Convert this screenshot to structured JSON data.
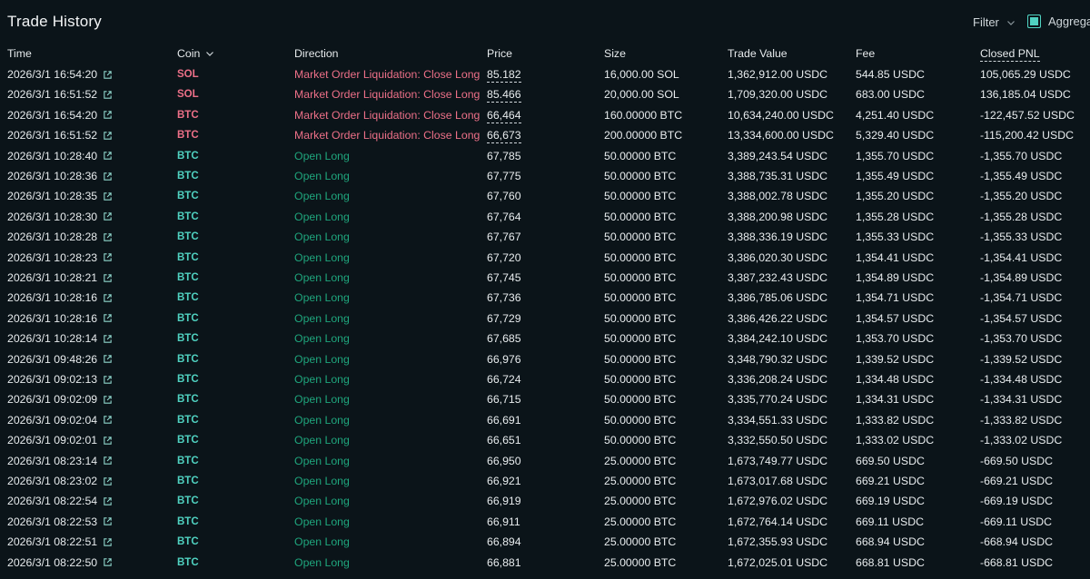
{
  "header": {
    "title": "Trade History",
    "filter_label": "Filter",
    "aggregate_label": "Aggregate"
  },
  "columns": {
    "time": "Time",
    "coin": "Coin",
    "direction": "Direction",
    "price": "Price",
    "size": "Size",
    "trade_value": "Trade Value",
    "fee": "Fee",
    "closed_pnl": "Closed PNL"
  },
  "colors": {
    "background": "#0b1419",
    "sell": "#ed7088",
    "buy_direction": "#1fa67d",
    "buy_coin": "#50d2c1"
  },
  "rows": [
    {
      "time": "2026/3/1 16:54:20",
      "coin": "SOL",
      "side": "sell",
      "direction": "Market Order Liquidation: Close Long",
      "price": "85.182",
      "size": "16,000.00 SOL",
      "value": "1,362,912.00 USDC",
      "fee": "544.85 USDC",
      "pnl": "105,065.29 USDC"
    },
    {
      "time": "2026/3/1 16:51:52",
      "coin": "SOL",
      "side": "sell",
      "direction": "Market Order Liquidation: Close Long",
      "price": "85.466",
      "size": "20,000.00 SOL",
      "value": "1,709,320.00 USDC",
      "fee": "683.00 USDC",
      "pnl": "136,185.04 USDC"
    },
    {
      "time": "2026/3/1 16:54:20",
      "coin": "BTC",
      "side": "sell",
      "direction": "Market Order Liquidation: Close Long",
      "price": "66,464",
      "size": "160.00000 BTC",
      "value": "10,634,240.00 USDC",
      "fee": "4,251.40 USDC",
      "pnl": "-122,457.52 USDC"
    },
    {
      "time": "2026/3/1 16:51:52",
      "coin": "BTC",
      "side": "sell",
      "direction": "Market Order Liquidation: Close Long",
      "price": "66,673",
      "size": "200.00000 BTC",
      "value": "13,334,600.00 USDC",
      "fee": "5,329.40 USDC",
      "pnl": "-115,200.42 USDC"
    },
    {
      "time": "2026/3/1 10:28:40",
      "coin": "BTC",
      "side": "buy",
      "direction": "Open Long",
      "price": "67,785",
      "size": "50.00000 BTC",
      "value": "3,389,243.54 USDC",
      "fee": "1,355.70 USDC",
      "pnl": "-1,355.70 USDC"
    },
    {
      "time": "2026/3/1 10:28:36",
      "coin": "BTC",
      "side": "buy",
      "direction": "Open Long",
      "price": "67,775",
      "size": "50.00000 BTC",
      "value": "3,388,735.31 USDC",
      "fee": "1,355.49 USDC",
      "pnl": "-1,355.49 USDC"
    },
    {
      "time": "2026/3/1 10:28:35",
      "coin": "BTC",
      "side": "buy",
      "direction": "Open Long",
      "price": "67,760",
      "size": "50.00000 BTC",
      "value": "3,388,002.78 USDC",
      "fee": "1,355.20 USDC",
      "pnl": "-1,355.20 USDC"
    },
    {
      "time": "2026/3/1 10:28:30",
      "coin": "BTC",
      "side": "buy",
      "direction": "Open Long",
      "price": "67,764",
      "size": "50.00000 BTC",
      "value": "3,388,200.98 USDC",
      "fee": "1,355.28 USDC",
      "pnl": "-1,355.28 USDC"
    },
    {
      "time": "2026/3/1 10:28:28",
      "coin": "BTC",
      "side": "buy",
      "direction": "Open Long",
      "price": "67,767",
      "size": "50.00000 BTC",
      "value": "3,388,336.19 USDC",
      "fee": "1,355.33 USDC",
      "pnl": "-1,355.33 USDC"
    },
    {
      "time": "2026/3/1 10:28:23",
      "coin": "BTC",
      "side": "buy",
      "direction": "Open Long",
      "price": "67,720",
      "size": "50.00000 BTC",
      "value": "3,386,020.30 USDC",
      "fee": "1,354.41 USDC",
      "pnl": "-1,354.41 USDC"
    },
    {
      "time": "2026/3/1 10:28:21",
      "coin": "BTC",
      "side": "buy",
      "direction": "Open Long",
      "price": "67,745",
      "size": "50.00000 BTC",
      "value": "3,387,232.43 USDC",
      "fee": "1,354.89 USDC",
      "pnl": "-1,354.89 USDC"
    },
    {
      "time": "2026/3/1 10:28:16",
      "coin": "BTC",
      "side": "buy",
      "direction": "Open Long",
      "price": "67,736",
      "size": "50.00000 BTC",
      "value": "3,386,785.06 USDC",
      "fee": "1,354.71 USDC",
      "pnl": "-1,354.71 USDC"
    },
    {
      "time": "2026/3/1 10:28:16",
      "coin": "BTC",
      "side": "buy",
      "direction": "Open Long",
      "price": "67,729",
      "size": "50.00000 BTC",
      "value": "3,386,426.22 USDC",
      "fee": "1,354.57 USDC",
      "pnl": "-1,354.57 USDC"
    },
    {
      "time": "2026/3/1 10:28:14",
      "coin": "BTC",
      "side": "buy",
      "direction": "Open Long",
      "price": "67,685",
      "size": "50.00000 BTC",
      "value": "3,384,242.10 USDC",
      "fee": "1,353.70 USDC",
      "pnl": "-1,353.70 USDC"
    },
    {
      "time": "2026/3/1 09:48:26",
      "coin": "BTC",
      "side": "buy",
      "direction": "Open Long",
      "price": "66,976",
      "size": "50.00000 BTC",
      "value": "3,348,790.32 USDC",
      "fee": "1,339.52 USDC",
      "pnl": "-1,339.52 USDC"
    },
    {
      "time": "2026/3/1 09:02:13",
      "coin": "BTC",
      "side": "buy",
      "direction": "Open Long",
      "price": "66,724",
      "size": "50.00000 BTC",
      "value": "3,336,208.24 USDC",
      "fee": "1,334.48 USDC",
      "pnl": "-1,334.48 USDC"
    },
    {
      "time": "2026/3/1 09:02:09",
      "coin": "BTC",
      "side": "buy",
      "direction": "Open Long",
      "price": "66,715",
      "size": "50.00000 BTC",
      "value": "3,335,770.24 USDC",
      "fee": "1,334.31 USDC",
      "pnl": "-1,334.31 USDC"
    },
    {
      "time": "2026/3/1 09:02:04",
      "coin": "BTC",
      "side": "buy",
      "direction": "Open Long",
      "price": "66,691",
      "size": "50.00000 BTC",
      "value": "3,334,551.33 USDC",
      "fee": "1,333.82 USDC",
      "pnl": "-1,333.82 USDC"
    },
    {
      "time": "2026/3/1 09:02:01",
      "coin": "BTC",
      "side": "buy",
      "direction": "Open Long",
      "price": "66,651",
      "size": "50.00000 BTC",
      "value": "3,332,550.50 USDC",
      "fee": "1,333.02 USDC",
      "pnl": "-1,333.02 USDC"
    },
    {
      "time": "2026/3/1 08:23:14",
      "coin": "BTC",
      "side": "buy",
      "direction": "Open Long",
      "price": "66,950",
      "size": "25.00000 BTC",
      "value": "1,673,749.77 USDC",
      "fee": "669.50 USDC",
      "pnl": "-669.50 USDC"
    },
    {
      "time": "2026/3/1 08:23:02",
      "coin": "BTC",
      "side": "buy",
      "direction": "Open Long",
      "price": "66,921",
      "size": "25.00000 BTC",
      "value": "1,673,017.68 USDC",
      "fee": "669.21 USDC",
      "pnl": "-669.21 USDC"
    },
    {
      "time": "2026/3/1 08:22:54",
      "coin": "BTC",
      "side": "buy",
      "direction": "Open Long",
      "price": "66,919",
      "size": "25.00000 BTC",
      "value": "1,672,976.02 USDC",
      "fee": "669.19 USDC",
      "pnl": "-669.19 USDC"
    },
    {
      "time": "2026/3/1 08:22:53",
      "coin": "BTC",
      "side": "buy",
      "direction": "Open Long",
      "price": "66,911",
      "size": "25.00000 BTC",
      "value": "1,672,764.14 USDC",
      "fee": "669.11 USDC",
      "pnl": "-669.11 USDC"
    },
    {
      "time": "2026/3/1 08:22:51",
      "coin": "BTC",
      "side": "buy",
      "direction": "Open Long",
      "price": "66,894",
      "size": "25.00000 BTC",
      "value": "1,672,355.93 USDC",
      "fee": "668.94 USDC",
      "pnl": "-668.94 USDC"
    },
    {
      "time": "2026/3/1 08:22:50",
      "coin": "BTC",
      "side": "buy",
      "direction": "Open Long",
      "price": "66,881",
      "size": "25.00000 BTC",
      "value": "1,672,025.01 USDC",
      "fee": "668.81 USDC",
      "pnl": "-668.81 USDC"
    }
  ]
}
